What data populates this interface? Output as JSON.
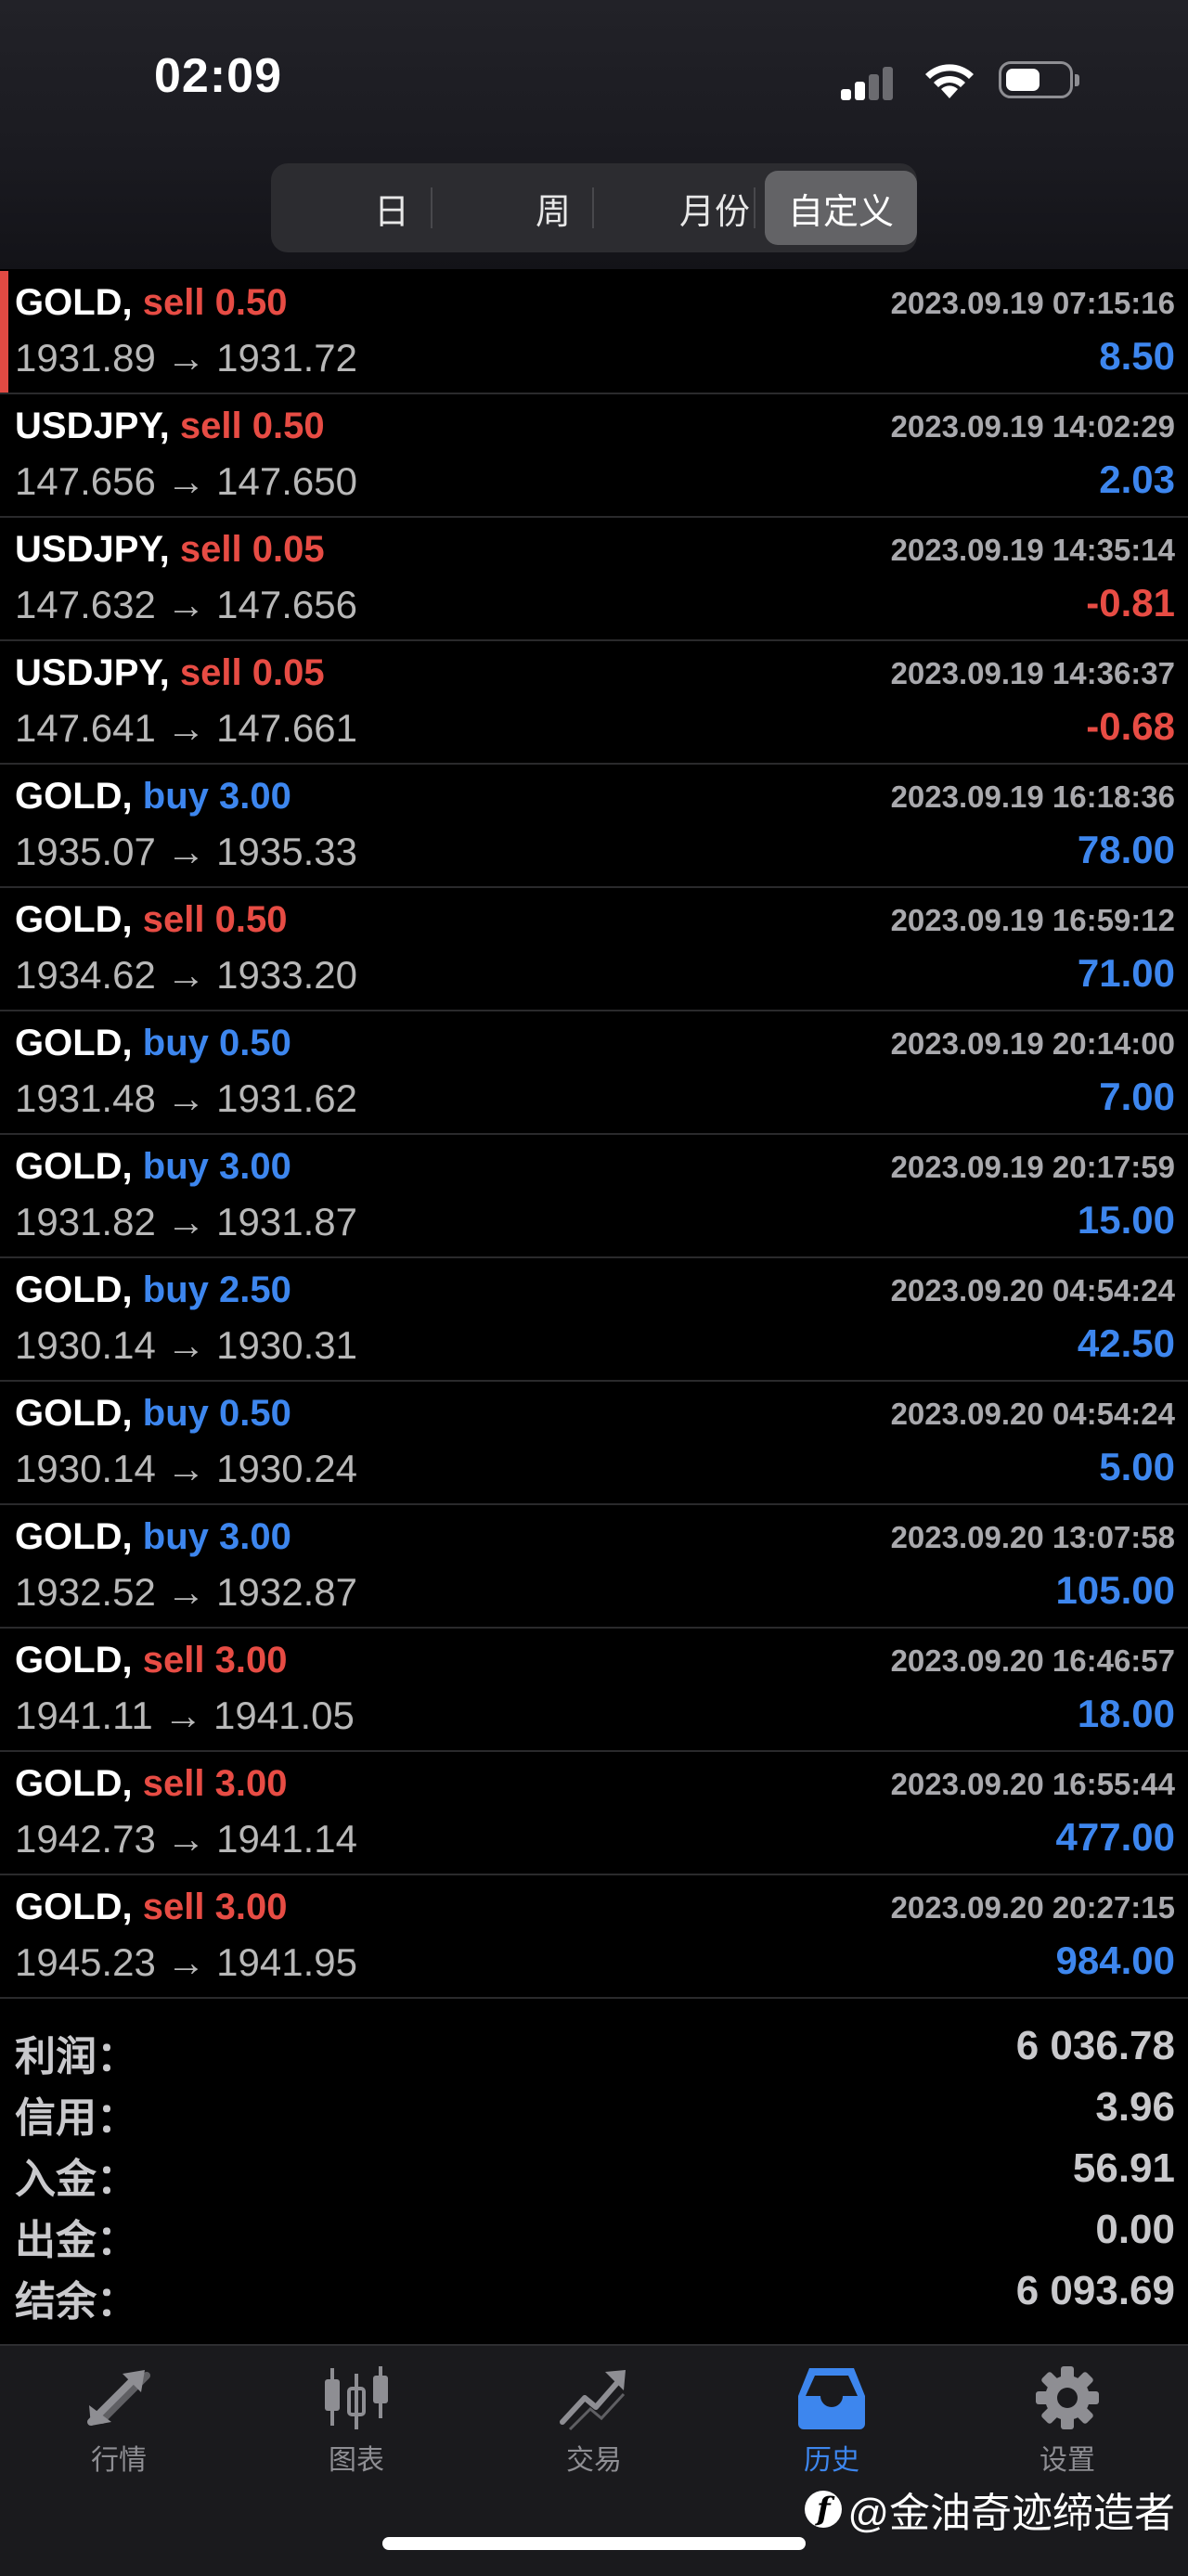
{
  "status_bar": {
    "time": "02:09"
  },
  "segments": [
    {
      "label": "日",
      "active": false
    },
    {
      "label": "周",
      "active": false
    },
    {
      "label": "月份",
      "active": false
    },
    {
      "label": "自定义",
      "active": true
    }
  ],
  "trades": [
    {
      "symbol": "GOLD,",
      "side": "sell",
      "lots": "0.50",
      "open": "1931.89",
      "close": "1931.72",
      "time": "2023.09.19 07:15:16",
      "profit": "8.50"
    },
    {
      "symbol": "USDJPY,",
      "side": "sell",
      "lots": "0.50",
      "open": "147.656",
      "close": "147.650",
      "time": "2023.09.19 14:02:29",
      "profit": "2.03"
    },
    {
      "symbol": "USDJPY,",
      "side": "sell",
      "lots": "0.05",
      "open": "147.632",
      "close": "147.656",
      "time": "2023.09.19 14:35:14",
      "profit": "-0.81"
    },
    {
      "symbol": "USDJPY,",
      "side": "sell",
      "lots": "0.05",
      "open": "147.641",
      "close": "147.661",
      "time": "2023.09.19 14:36:37",
      "profit": "-0.68"
    },
    {
      "symbol": "GOLD,",
      "side": "buy",
      "lots": "3.00",
      "open": "1935.07",
      "close": "1935.33",
      "time": "2023.09.19 16:18:36",
      "profit": "78.00"
    },
    {
      "symbol": "GOLD,",
      "side": "sell",
      "lots": "0.50",
      "open": "1934.62",
      "close": "1933.20",
      "time": "2023.09.19 16:59:12",
      "profit": "71.00"
    },
    {
      "symbol": "GOLD,",
      "side": "buy",
      "lots": "0.50",
      "open": "1931.48",
      "close": "1931.62",
      "time": "2023.09.19 20:14:00",
      "profit": "7.00"
    },
    {
      "symbol": "GOLD,",
      "side": "buy",
      "lots": "3.00",
      "open": "1931.82",
      "close": "1931.87",
      "time": "2023.09.19 20:17:59",
      "profit": "15.00"
    },
    {
      "symbol": "GOLD,",
      "side": "buy",
      "lots": "2.50",
      "open": "1930.14",
      "close": "1930.31",
      "time": "2023.09.20 04:54:24",
      "profit": "42.50"
    },
    {
      "symbol": "GOLD,",
      "side": "buy",
      "lots": "0.50",
      "open": "1930.14",
      "close": "1930.24",
      "time": "2023.09.20 04:54:24",
      "profit": "5.00"
    },
    {
      "symbol": "GOLD,",
      "side": "buy",
      "lots": "3.00",
      "open": "1932.52",
      "close": "1932.87",
      "time": "2023.09.20 13:07:58",
      "profit": "105.00"
    },
    {
      "symbol": "GOLD,",
      "side": "sell",
      "lots": "3.00",
      "open": "1941.11",
      "close": "1941.05",
      "time": "2023.09.20 16:46:57",
      "profit": "18.00"
    },
    {
      "symbol": "GOLD,",
      "side": "sell",
      "lots": "3.00",
      "open": "1942.73",
      "close": "1941.14",
      "time": "2023.09.20 16:55:44",
      "profit": "477.00"
    },
    {
      "symbol": "GOLD,",
      "side": "sell",
      "lots": "3.00",
      "open": "1945.23",
      "close": "1941.95",
      "time": "2023.09.20 20:27:15",
      "profit": "984.00"
    }
  ],
  "arrow": "→",
  "summary": [
    {
      "label": "利润：",
      "value": "6 036.78"
    },
    {
      "label": "信用：",
      "value": "3.96"
    },
    {
      "label": "入金：",
      "value": "56.91"
    },
    {
      "label": "出金：",
      "value": "0.00"
    },
    {
      "label": "结余：",
      "value": "6 093.69"
    }
  ],
  "tabs": [
    {
      "label": "行情",
      "icon": "quotes-icon",
      "active": false
    },
    {
      "label": "图表",
      "icon": "chart-icon",
      "active": false
    },
    {
      "label": "交易",
      "icon": "trade-icon",
      "active": false
    },
    {
      "label": "历史",
      "icon": "history-icon",
      "active": true
    },
    {
      "label": "设置",
      "icon": "gear-icon",
      "active": false
    }
  ],
  "watermark": "@金油奇迹缔造者",
  "colors": {
    "sell": "#e74c44",
    "buy": "#3d86ee",
    "selected_bar": "#e24a43"
  }
}
